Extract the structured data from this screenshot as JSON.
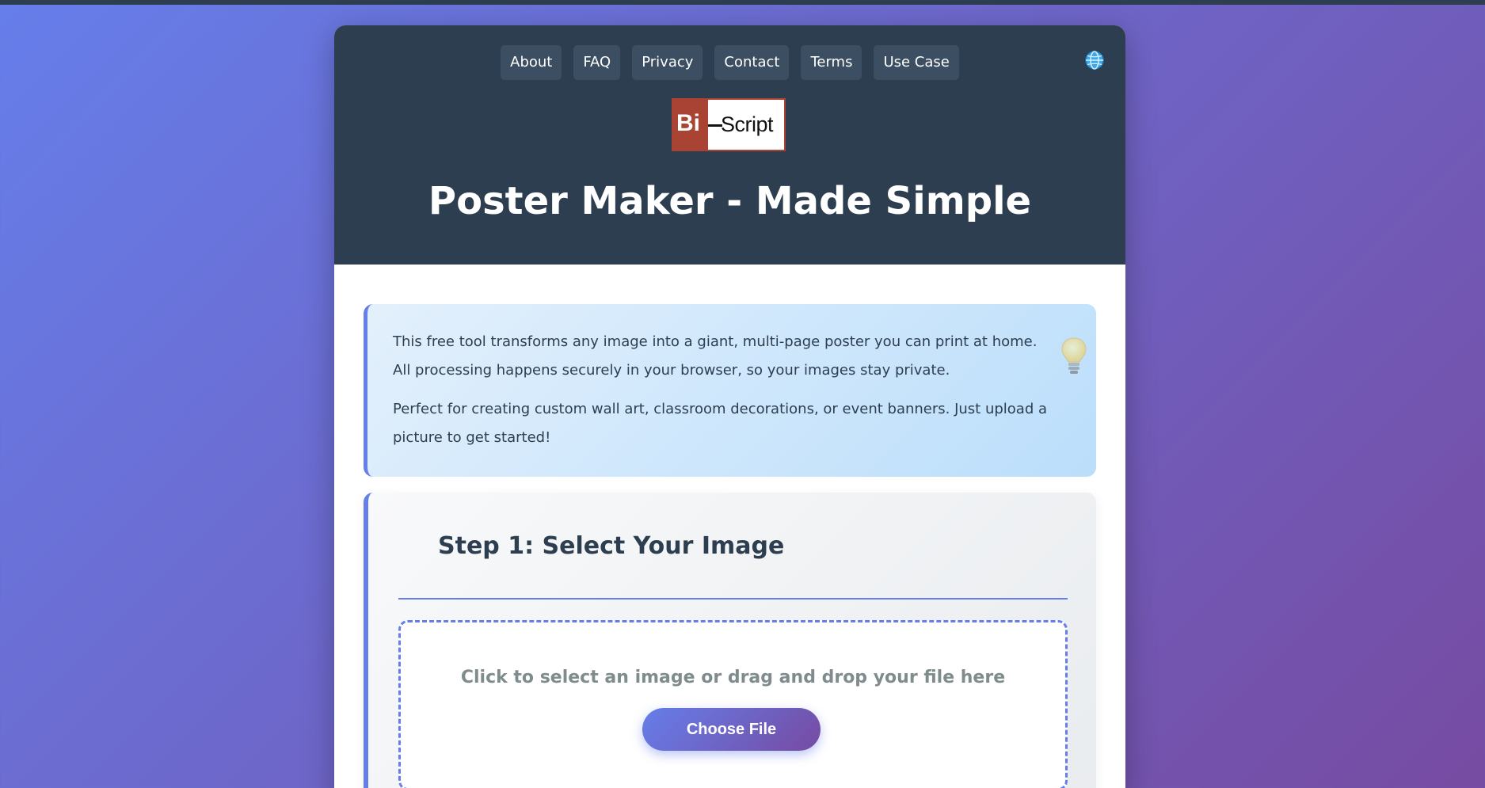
{
  "nav": {
    "items": [
      {
        "label": "About"
      },
      {
        "label": "FAQ"
      },
      {
        "label": "Privacy"
      },
      {
        "label": "Contact"
      },
      {
        "label": "Terms"
      },
      {
        "label": "Use Case"
      }
    ],
    "language_icon": "globe-icon"
  },
  "logo": {
    "left_text": "Bi",
    "right_text": "Script",
    "colors": {
      "brand": "#a94434"
    }
  },
  "header": {
    "title": "Poster Maker - Made Simple"
  },
  "info": {
    "paragraph1": "This free tool transforms any image into a giant, multi-page poster you can print at home. All processing happens securely in your browser, so your images stay private.",
    "paragraph2": "Perfect for creating custom wall art, classroom decorations, or event banners. Just upload a picture to get started!",
    "icon": "lightbulb-icon"
  },
  "step1": {
    "title": "Step 1: Select Your Image",
    "drop_text": "Click to select an image or drag and drop your file here",
    "button_label": "Choose File"
  },
  "colors": {
    "accent": "#667eea",
    "accent_end": "#764ba2",
    "header_bg": "#2c3e50",
    "text_dark": "#2c3e50",
    "text_muted": "#7f8c8d"
  }
}
